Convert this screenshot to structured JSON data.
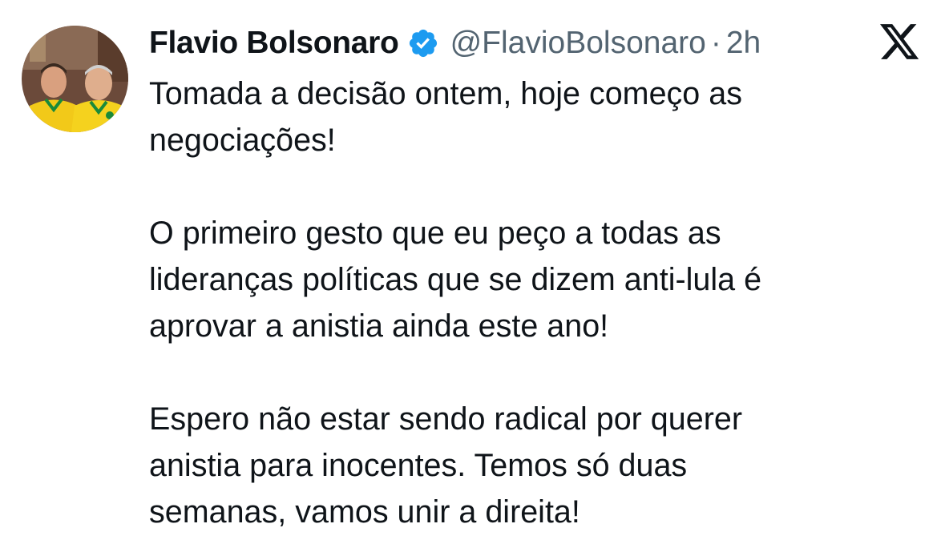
{
  "author": {
    "name": "Flavio Bolsonaro",
    "handle": "@FlavioBolsonaro",
    "separator": "·",
    "time": "2h",
    "verified": true,
    "verified_color": "#1d9bf0"
  },
  "logo": "x-logo-icon",
  "tweet": {
    "lines": [
      "Tomada a decisão ontem, hoje começo as",
      "negociações!",
      "",
      "O primeiro gesto que eu peço a todas as",
      "lideranças políticas que se dizem anti-lula é",
      "aprovar a anistia ainda este ano!",
      "",
      "Espero não estar sendo radical por querer",
      "anistia para inocentes. Temos só duas",
      "semanas, vamos unir a direita!"
    ]
  }
}
